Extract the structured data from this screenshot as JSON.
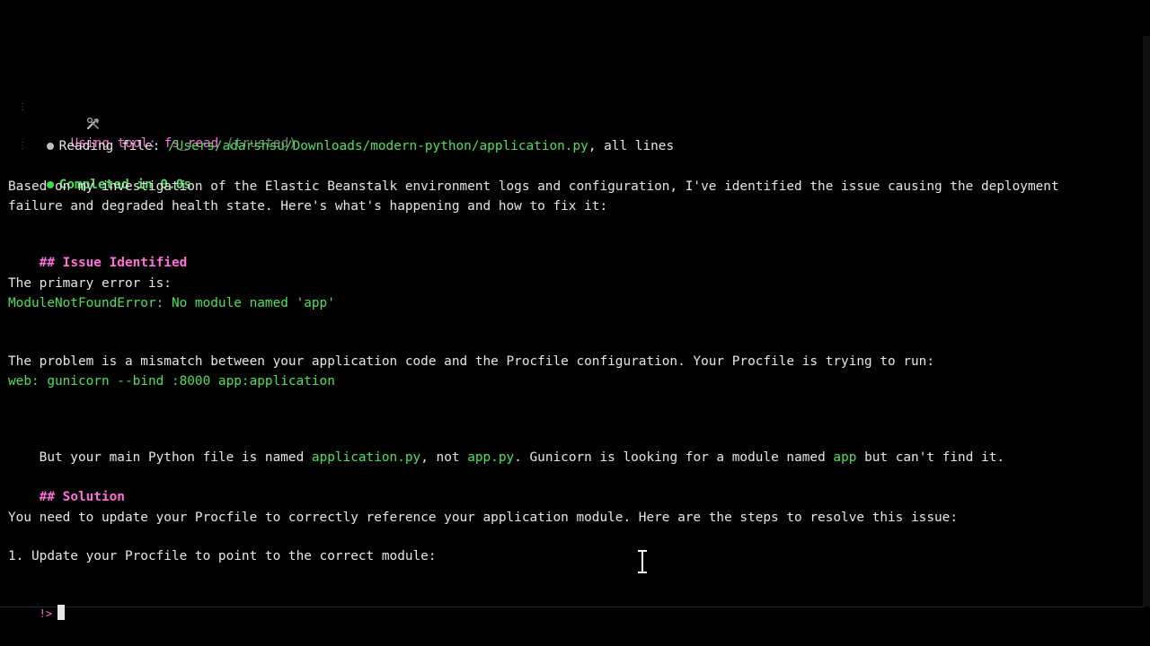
{
  "tool": {
    "icon": "hammer-wrench-icon",
    "prefix": "Using tool: ",
    "name": "fs_read",
    "trust": " (trusted)"
  },
  "reading": {
    "label": "Reading file: ",
    "path": "/Users/adarshsu/Downloads/modern-python/application.py",
    "suffix": ", all lines"
  },
  "completed": "Completed in 0.0s",
  "intro": {
    "line1": "Based on my investigation of the Elastic Beanstalk environment logs and configuration, I've identified the issue causing the deployment",
    "line2": "failure and degraded health state. Here's what's happening and how to fix it:"
  },
  "issue_heading": {
    "hashes": "## ",
    "title": "Issue Identified"
  },
  "primary_error_label": "The primary error is:",
  "error_text": "ModuleNotFoundError: No module named 'app'",
  "problem_text": "The problem is a mismatch between your application code and the Procfile configuration. Your Procfile is trying to run:",
  "procfile_cmd": "web: gunicorn --bind :8000 app:application",
  "but": {
    "p1": "But your main Python file is named ",
    "c1": "application.py",
    "p2": ", not ",
    "c2": "app.py",
    "p3": ". Gunicorn is looking for a module named ",
    "c3": "app",
    "p4": " but can't find it."
  },
  "solution_heading": {
    "hashes": "## ",
    "title": "Solution"
  },
  "solution_text": "You need to update your Procfile to correctly reference your application module. Here are the steps to resolve this issue:",
  "step1": "1. Update your Procfile to point to the correct module:",
  "prompt": "!>",
  "colors": {
    "background": "#000000",
    "accent_pink": "#ff6fd8",
    "accent_green": "#4ee05a",
    "text": "#e6e6e6"
  }
}
